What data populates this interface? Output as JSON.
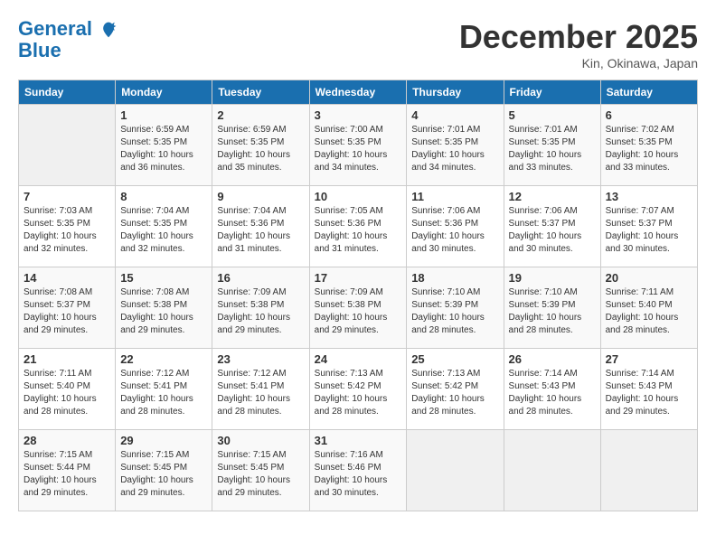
{
  "logo": {
    "line1": "General",
    "line2": "Blue"
  },
  "title": "December 2025",
  "location": "Kin, Okinawa, Japan",
  "weekdays": [
    "Sunday",
    "Monday",
    "Tuesday",
    "Wednesday",
    "Thursday",
    "Friday",
    "Saturday"
  ],
  "weeks": [
    [
      {
        "day": "",
        "sunrise": "",
        "sunset": "",
        "daylight": ""
      },
      {
        "day": "1",
        "sunrise": "Sunrise: 6:59 AM",
        "sunset": "Sunset: 5:35 PM",
        "daylight": "Daylight: 10 hours and 36 minutes."
      },
      {
        "day": "2",
        "sunrise": "Sunrise: 6:59 AM",
        "sunset": "Sunset: 5:35 PM",
        "daylight": "Daylight: 10 hours and 35 minutes."
      },
      {
        "day": "3",
        "sunrise": "Sunrise: 7:00 AM",
        "sunset": "Sunset: 5:35 PM",
        "daylight": "Daylight: 10 hours and 34 minutes."
      },
      {
        "day": "4",
        "sunrise": "Sunrise: 7:01 AM",
        "sunset": "Sunset: 5:35 PM",
        "daylight": "Daylight: 10 hours and 34 minutes."
      },
      {
        "day": "5",
        "sunrise": "Sunrise: 7:01 AM",
        "sunset": "Sunset: 5:35 PM",
        "daylight": "Daylight: 10 hours and 33 minutes."
      },
      {
        "day": "6",
        "sunrise": "Sunrise: 7:02 AM",
        "sunset": "Sunset: 5:35 PM",
        "daylight": "Daylight: 10 hours and 33 minutes."
      }
    ],
    [
      {
        "day": "7",
        "sunrise": "Sunrise: 7:03 AM",
        "sunset": "Sunset: 5:35 PM",
        "daylight": "Daylight: 10 hours and 32 minutes."
      },
      {
        "day": "8",
        "sunrise": "Sunrise: 7:04 AM",
        "sunset": "Sunset: 5:35 PM",
        "daylight": "Daylight: 10 hours and 32 minutes."
      },
      {
        "day": "9",
        "sunrise": "Sunrise: 7:04 AM",
        "sunset": "Sunset: 5:36 PM",
        "daylight": "Daylight: 10 hours and 31 minutes."
      },
      {
        "day": "10",
        "sunrise": "Sunrise: 7:05 AM",
        "sunset": "Sunset: 5:36 PM",
        "daylight": "Daylight: 10 hours and 31 minutes."
      },
      {
        "day": "11",
        "sunrise": "Sunrise: 7:06 AM",
        "sunset": "Sunset: 5:36 PM",
        "daylight": "Daylight: 10 hours and 30 minutes."
      },
      {
        "day": "12",
        "sunrise": "Sunrise: 7:06 AM",
        "sunset": "Sunset: 5:37 PM",
        "daylight": "Daylight: 10 hours and 30 minutes."
      },
      {
        "day": "13",
        "sunrise": "Sunrise: 7:07 AM",
        "sunset": "Sunset: 5:37 PM",
        "daylight": "Daylight: 10 hours and 30 minutes."
      }
    ],
    [
      {
        "day": "14",
        "sunrise": "Sunrise: 7:08 AM",
        "sunset": "Sunset: 5:37 PM",
        "daylight": "Daylight: 10 hours and 29 minutes."
      },
      {
        "day": "15",
        "sunrise": "Sunrise: 7:08 AM",
        "sunset": "Sunset: 5:38 PM",
        "daylight": "Daylight: 10 hours and 29 minutes."
      },
      {
        "day": "16",
        "sunrise": "Sunrise: 7:09 AM",
        "sunset": "Sunset: 5:38 PM",
        "daylight": "Daylight: 10 hours and 29 minutes."
      },
      {
        "day": "17",
        "sunrise": "Sunrise: 7:09 AM",
        "sunset": "Sunset: 5:38 PM",
        "daylight": "Daylight: 10 hours and 29 minutes."
      },
      {
        "day": "18",
        "sunrise": "Sunrise: 7:10 AM",
        "sunset": "Sunset: 5:39 PM",
        "daylight": "Daylight: 10 hours and 28 minutes."
      },
      {
        "day": "19",
        "sunrise": "Sunrise: 7:10 AM",
        "sunset": "Sunset: 5:39 PM",
        "daylight": "Daylight: 10 hours and 28 minutes."
      },
      {
        "day": "20",
        "sunrise": "Sunrise: 7:11 AM",
        "sunset": "Sunset: 5:40 PM",
        "daylight": "Daylight: 10 hours and 28 minutes."
      }
    ],
    [
      {
        "day": "21",
        "sunrise": "Sunrise: 7:11 AM",
        "sunset": "Sunset: 5:40 PM",
        "daylight": "Daylight: 10 hours and 28 minutes."
      },
      {
        "day": "22",
        "sunrise": "Sunrise: 7:12 AM",
        "sunset": "Sunset: 5:41 PM",
        "daylight": "Daylight: 10 hours and 28 minutes."
      },
      {
        "day": "23",
        "sunrise": "Sunrise: 7:12 AM",
        "sunset": "Sunset: 5:41 PM",
        "daylight": "Daylight: 10 hours and 28 minutes."
      },
      {
        "day": "24",
        "sunrise": "Sunrise: 7:13 AM",
        "sunset": "Sunset: 5:42 PM",
        "daylight": "Daylight: 10 hours and 28 minutes."
      },
      {
        "day": "25",
        "sunrise": "Sunrise: 7:13 AM",
        "sunset": "Sunset: 5:42 PM",
        "daylight": "Daylight: 10 hours and 28 minutes."
      },
      {
        "day": "26",
        "sunrise": "Sunrise: 7:14 AM",
        "sunset": "Sunset: 5:43 PM",
        "daylight": "Daylight: 10 hours and 28 minutes."
      },
      {
        "day": "27",
        "sunrise": "Sunrise: 7:14 AM",
        "sunset": "Sunset: 5:43 PM",
        "daylight": "Daylight: 10 hours and 29 minutes."
      }
    ],
    [
      {
        "day": "28",
        "sunrise": "Sunrise: 7:15 AM",
        "sunset": "Sunset: 5:44 PM",
        "daylight": "Daylight: 10 hours and 29 minutes."
      },
      {
        "day": "29",
        "sunrise": "Sunrise: 7:15 AM",
        "sunset": "Sunset: 5:45 PM",
        "daylight": "Daylight: 10 hours and 29 minutes."
      },
      {
        "day": "30",
        "sunrise": "Sunrise: 7:15 AM",
        "sunset": "Sunset: 5:45 PM",
        "daylight": "Daylight: 10 hours and 29 minutes."
      },
      {
        "day": "31",
        "sunrise": "Sunrise: 7:16 AM",
        "sunset": "Sunset: 5:46 PM",
        "daylight": "Daylight: 10 hours and 30 minutes."
      },
      {
        "day": "",
        "sunrise": "",
        "sunset": "",
        "daylight": ""
      },
      {
        "day": "",
        "sunrise": "",
        "sunset": "",
        "daylight": ""
      },
      {
        "day": "",
        "sunrise": "",
        "sunset": "",
        "daylight": ""
      }
    ]
  ]
}
